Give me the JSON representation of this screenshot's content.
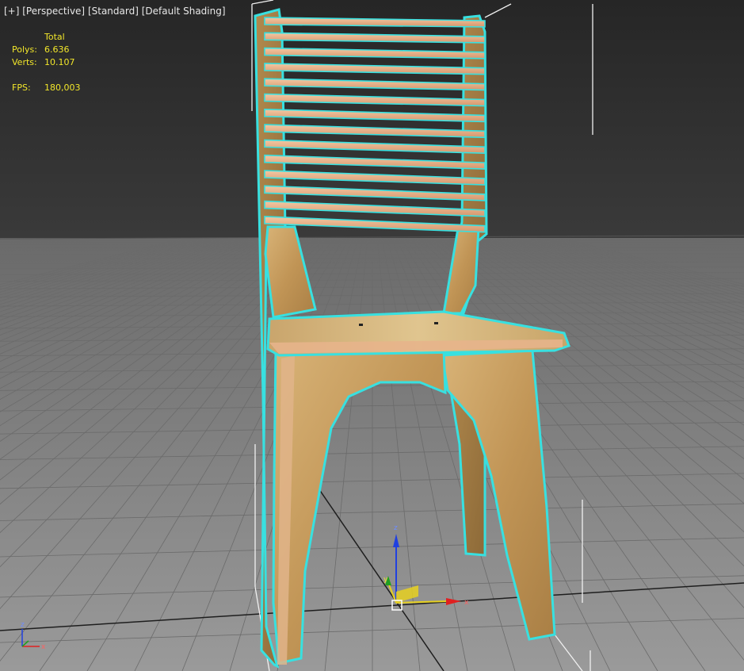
{
  "viewport": {
    "menu_plus": "[+]",
    "menu_view": "[Perspective]",
    "menu_style": "[Standard]",
    "menu_shading": "[Default Shading]"
  },
  "stats": {
    "header": "Total",
    "polys_label": "Polys:",
    "polys_value": "6.636",
    "verts_label": "Verts:",
    "verts_value": "10.107",
    "fps_label": "FPS:",
    "fps_value": "180,003"
  },
  "gizmo": {
    "x": "x",
    "y": "y",
    "z": "z"
  },
  "world_axis": {
    "x": "x",
    "z": "z"
  },
  "colors": {
    "selection_outline": "#38e0e0",
    "stats_text": "#f2e62a",
    "grid_line": "#6b6b6b",
    "wood": "#c9a26a",
    "slat": "#e9b58f",
    "axis_x": "#e02020",
    "axis_y": "#e6d020",
    "axis_z": "#2040e0"
  }
}
